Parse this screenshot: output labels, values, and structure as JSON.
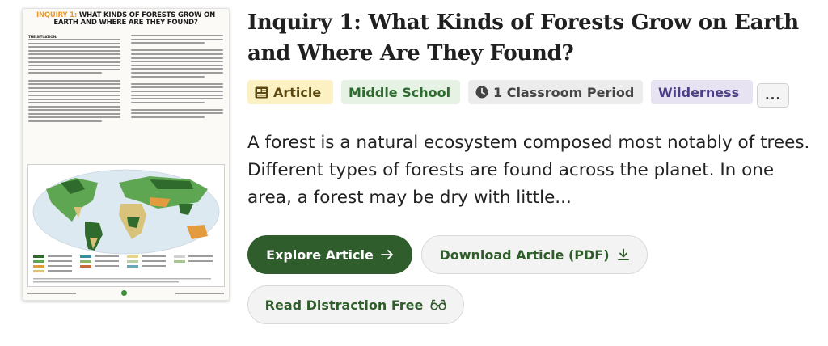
{
  "thumbnail": {
    "heading_prefix": "INQUIRY 1:",
    "heading_rest": " WHAT KINDS OF FORESTS GROW ON EARTH AND WHERE ARE THEY FOUND?",
    "lede": "THE SITUATION:",
    "colors": {
      "ocean": "#dde9f0",
      "land_green": "#5fa653",
      "land_dark": "#2f6b2c",
      "land_tan": "#d9c27a",
      "land_orange": "#e49b3d",
      "accent_orange": "#e89a2b"
    }
  },
  "resource": {
    "title": "Inquiry 1: What Kinds of Forests Grow on Earth and Where Are They Found?",
    "description": "A forest is a natural ecosystem composed most notably of trees. Different types of forests are found across the planet. In one area, a forest may be dry with little..."
  },
  "tags": {
    "article": {
      "label": "Article",
      "icon": "article-icon"
    },
    "level": {
      "label": "Middle School"
    },
    "period": {
      "label": "1 Classroom Period",
      "icon": "clock-icon"
    },
    "topic": {
      "label": "Wilderness"
    },
    "more": {
      "label": "..."
    }
  },
  "actions": {
    "explore": {
      "label": "Explore Article",
      "icon": "arrow-right-icon"
    },
    "download": {
      "label": "Download Article (PDF)",
      "icon": "download-icon"
    },
    "read": {
      "label": "Read Distraction Free",
      "icon": "glasses-icon"
    }
  },
  "theme": {
    "primary_green": "#2f5d2b",
    "article_tag_bg": "#fbf1c3",
    "level_tag_bg": "#e6f2e4",
    "period_tag_bg": "#ececec",
    "topic_tag_bg": "#e7e3f2"
  }
}
